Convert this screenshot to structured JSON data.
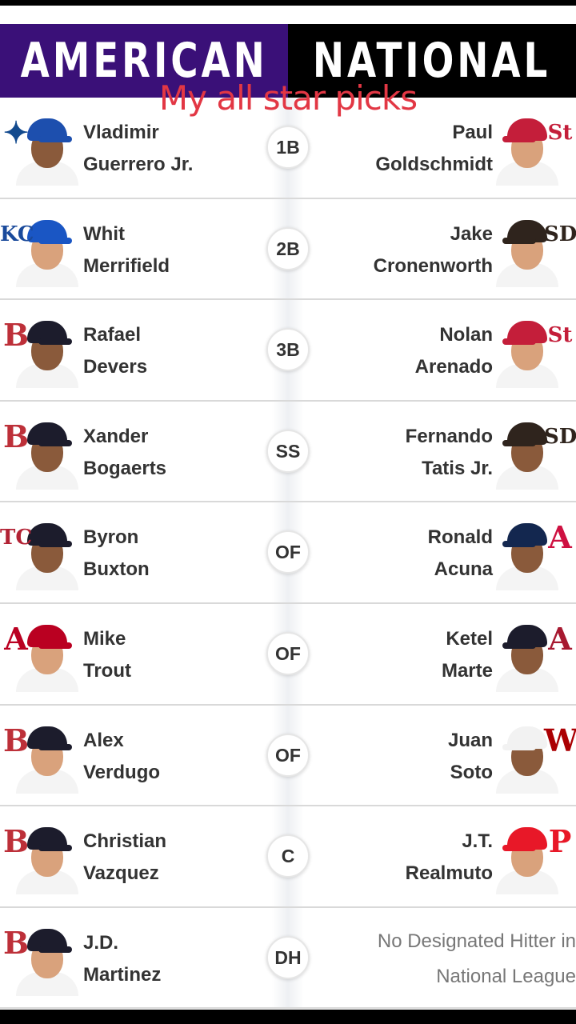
{
  "header": {
    "al_label": "AMERICAN",
    "nl_label": "NATIONAL",
    "al_color": "#3a1078",
    "nl_color": "#000000"
  },
  "overlay_caption": "My all star picks",
  "rows": [
    {
      "position": "1B",
      "al": {
        "first": "Vladimir",
        "last": "Guerrero Jr.",
        "team_icon": "blue-jays-logo-icon",
        "logo_glyph": "✦",
        "logo_color": "#134a8e",
        "cap": "#1d4fae",
        "skin": "dark"
      },
      "nl": {
        "first": "Paul",
        "last": "Goldschmidt",
        "team_icon": "cardinals-logo-icon",
        "logo_glyph": "St",
        "logo_color": "#c41e3a",
        "cap": "#c41e3a",
        "skin": "light"
      }
    },
    {
      "position": "2B",
      "al": {
        "first": "Whit",
        "last": "Merrifield",
        "team_icon": "royals-logo-icon",
        "logo_glyph": "KC",
        "logo_color": "#1a4a9b",
        "cap": "#1a56c4",
        "skin": "light"
      },
      "nl": {
        "first": "Jake",
        "last": "Cronenworth",
        "team_icon": "padres-logo-icon",
        "logo_glyph": "SD",
        "logo_color": "#2f241d",
        "cap": "#2f241d",
        "skin": "light"
      }
    },
    {
      "position": "3B",
      "al": {
        "first": "Rafael",
        "last": "Devers",
        "team_icon": "red-sox-logo-icon",
        "logo_glyph": "B",
        "logo_color": "#bd3039",
        "cap": "#1c1c2c",
        "skin": "dark"
      },
      "nl": {
        "first": "Nolan",
        "last": "Arenado",
        "team_icon": "cardinals-logo-icon",
        "logo_glyph": "St",
        "logo_color": "#c41e3a",
        "cap": "#c41e3a",
        "skin": "light"
      }
    },
    {
      "position": "SS",
      "al": {
        "first": "Xander",
        "last": "Bogaerts",
        "team_icon": "red-sox-logo-icon",
        "logo_glyph": "B",
        "logo_color": "#bd3039",
        "cap": "#1c1c2c",
        "skin": "dark"
      },
      "nl": {
        "first": "Fernando",
        "last": "Tatis Jr.",
        "team_icon": "padres-logo-icon",
        "logo_glyph": "SD",
        "logo_color": "#2f241d",
        "cap": "#2f241d",
        "skin": "dark"
      }
    },
    {
      "position": "OF",
      "al": {
        "first": "Byron",
        "last": "Buxton",
        "team_icon": "twins-logo-icon",
        "logo_glyph": "TC",
        "logo_color": "#b22234",
        "cap": "#1c1c2c",
        "skin": "dark"
      },
      "nl": {
        "first": "Ronald",
        "last": "Acuna",
        "team_icon": "braves-logo-icon",
        "logo_glyph": "A",
        "logo_color": "#ce1141",
        "cap": "#13274f",
        "skin": "dark"
      }
    },
    {
      "position": "OF",
      "al": {
        "first": "Mike",
        "last": "Trout",
        "team_icon": "angels-logo-icon",
        "logo_glyph": "A",
        "logo_color": "#ba0021",
        "cap": "#ba0021",
        "skin": "light"
      },
      "nl": {
        "first": "Ketel",
        "last": "Marte",
        "team_icon": "diamondbacks-logo-icon",
        "logo_glyph": "A",
        "logo_color": "#a71930",
        "cap": "#1c1c2c",
        "skin": "dark"
      }
    },
    {
      "position": "OF",
      "al": {
        "first": "Alex",
        "last": "Verdugo",
        "team_icon": "red-sox-logo-icon",
        "logo_glyph": "B",
        "logo_color": "#bd3039",
        "cap": "#1c1c2c",
        "skin": "light"
      },
      "nl": {
        "first": "Juan",
        "last": "Soto",
        "team_icon": "nationals-logo-icon",
        "logo_glyph": "W",
        "logo_color": "#ab0003",
        "cap": "#f2f2f2",
        "skin": "dark"
      }
    },
    {
      "position": "C",
      "al": {
        "first": "Christian",
        "last": "Vazquez",
        "team_icon": "red-sox-logo-icon",
        "logo_glyph": "B",
        "logo_color": "#bd3039",
        "cap": "#1c1c2c",
        "skin": "light"
      },
      "nl": {
        "first": "J.T.",
        "last": "Realmuto",
        "team_icon": "phillies-logo-icon",
        "logo_glyph": "P",
        "logo_color": "#e81828",
        "cap": "#e81828",
        "skin": "light"
      }
    },
    {
      "position": "DH",
      "al": {
        "first": "J.D.",
        "last": "Martinez",
        "team_icon": "red-sox-logo-icon",
        "logo_glyph": "B",
        "logo_color": "#bd3039",
        "cap": "#1c1c2c",
        "skin": "light"
      },
      "nl_note": {
        "line1": "No Designated Hitter in",
        "line2": "National League"
      }
    }
  ]
}
